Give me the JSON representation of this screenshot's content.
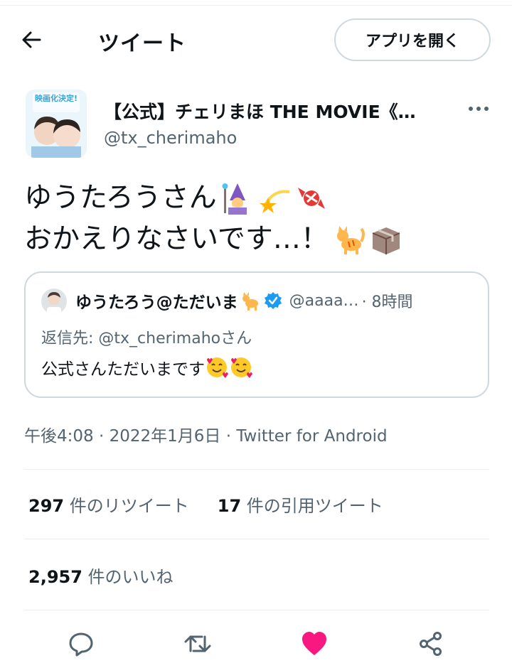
{
  "header": {
    "title": "ツイート",
    "open_app_label": "アプリを開く"
  },
  "author": {
    "name": "【公式】チェリまほ THE MOVIE《…",
    "handle": "@tx_cherimaho",
    "avatar_badge": "映画化決定!"
  },
  "tweet": {
    "line1": "ゆうたろうさん",
    "line1_emojis": [
      "wizard-emoji",
      "dizzy-star-emoji",
      "candy-emoji"
    ],
    "line2": "おかえりなさいです…！",
    "line2_emojis": [
      "cat-emoji",
      "package-emoji"
    ]
  },
  "quote": {
    "name": "ゆうたろう@ただいま",
    "handle": "@aaaa…",
    "time": "· 8時間",
    "reply_prefix": "返信先: ",
    "reply_mention": "@tx_cherimaho",
    "reply_suffix": "さん",
    "body": "公式さんただいまです"
  },
  "meta": {
    "timestamp": "午後4:08 · 2022年1月6日 · Twitter for Android"
  },
  "stats": {
    "retweets_count": "297",
    "retweets_label": " 件のリツイート",
    "quotes_count": "17",
    "quotes_label": " 件の引用ツイート",
    "likes_count": "2,957",
    "likes_label": " 件のいいね"
  },
  "colors": {
    "text": "#0f1419",
    "secondary": "#536471",
    "border": "#cfd9de",
    "like_pink": "#f91880",
    "verified_blue": "#1d9bf0"
  }
}
